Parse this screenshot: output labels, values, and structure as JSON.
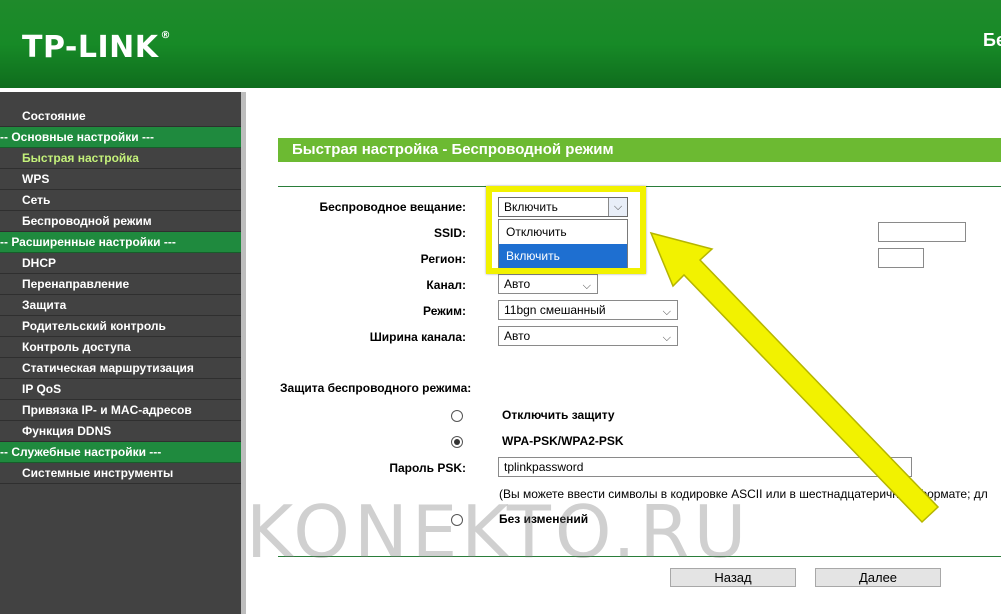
{
  "header": {
    "logo": "TP-LINK",
    "right_text": "Бес"
  },
  "sidebar": {
    "items": [
      {
        "label": "Состояние",
        "type": "item"
      },
      {
        "label": "-- Основные настройки ---",
        "type": "section"
      },
      {
        "label": "Быстрая настройка",
        "type": "item",
        "active": true
      },
      {
        "label": "WPS",
        "type": "item"
      },
      {
        "label": "Сеть",
        "type": "item"
      },
      {
        "label": "Беспроводной режим",
        "type": "item"
      },
      {
        "label": "-- Расширенные настройки ---",
        "type": "section"
      },
      {
        "label": "DHCP",
        "type": "item"
      },
      {
        "label": "Перенаправление",
        "type": "item"
      },
      {
        "label": "Защита",
        "type": "item"
      },
      {
        "label": "Родительский контроль",
        "type": "item"
      },
      {
        "label": "Контроль доступа",
        "type": "item"
      },
      {
        "label": "Статическая маршрутизация",
        "type": "item"
      },
      {
        "label": "IP QoS",
        "type": "item"
      },
      {
        "label": "Привязка IP- и MAC-адресов",
        "type": "item"
      },
      {
        "label": "Функция DDNS",
        "type": "item"
      },
      {
        "label": "-- Служебные настройки ---",
        "type": "section"
      },
      {
        "label": "Системные инструменты",
        "type": "item"
      }
    ]
  },
  "page": {
    "title": "Быстрая настройка - Беспроводной режим",
    "broadcast_label": "Беспроводное вещание:",
    "broadcast_value": "Включить",
    "broadcast_options": [
      "Отключить",
      "Включить"
    ],
    "ssid_label": "SSID:",
    "region_label": "Регион:",
    "channel_label": "Канал:",
    "channel_value": "Авто",
    "mode_label": "Режим:",
    "mode_value": "11bgn смешанный",
    "width_label": "Ширина канала:",
    "width_value": "Авто",
    "security_label": "Защита беспроводного режима:",
    "opt_disable": "Отключить защиту",
    "opt_wpa": "WPA-PSK/WPA2-PSK",
    "psk_label": "Пароль PSK:",
    "psk_value": "tplinkpassword",
    "psk_note": "(Вы можете ввести символы в кодировке ASCII или в шестнадцатеричном формате; дл",
    "opt_nochange": "Без изменений",
    "back_button": "Назад",
    "next_button": "Далее"
  },
  "watermark": "KONEKTO.RU",
  "colors": {
    "header_green": "#178a27",
    "section_green": "#1f8a3e",
    "title_green": "#6cba32",
    "highlight": "#f2f200",
    "active_item": "#c3f07a"
  }
}
